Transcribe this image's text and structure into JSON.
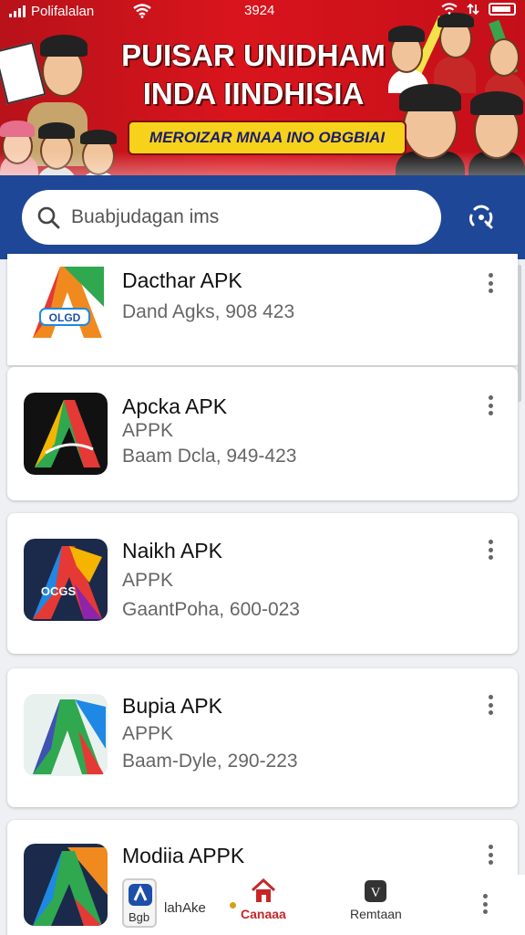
{
  "status_bar": {
    "carrier": "Polifalalan",
    "time": "3924"
  },
  "banner": {
    "title_line1": "PUISAR UNIDHAM",
    "title_line2": "INDA IINDHISIA",
    "subtitle": "MEROIZAR MNAA INO OBGBIAI"
  },
  "search": {
    "placeholder": "Buabjudagan ims",
    "search_icon": "search-icon",
    "scan_icon": "scan-icon"
  },
  "apps": [
    {
      "name": "Dacthar APK",
      "type": "",
      "meta": "Dand Agks, 908 423",
      "icon_text": "OLGD"
    },
    {
      "name": "Apcka APK",
      "type": "APPK",
      "meta": "Baam Dcla, 949-423",
      "icon_text": ""
    },
    {
      "name": "Naikh APK",
      "type": "APPK",
      "meta": "GaantPoha, 600-023",
      "icon_text": "OCGS"
    },
    {
      "name": "Bupia APK",
      "type": "APPK",
      "meta": "Baam-Dyle, 290-223",
      "icon_text": ""
    },
    {
      "name": "Modiia APPK",
      "type": "",
      "meta": "",
      "icon_text": ""
    }
  ],
  "bottom_nav": {
    "item1_badge": "Bgb",
    "item1_label": "lahAke",
    "item2_label": "Canaaa",
    "item3_label": "Remtaan",
    "item2_color": "#c62828"
  }
}
